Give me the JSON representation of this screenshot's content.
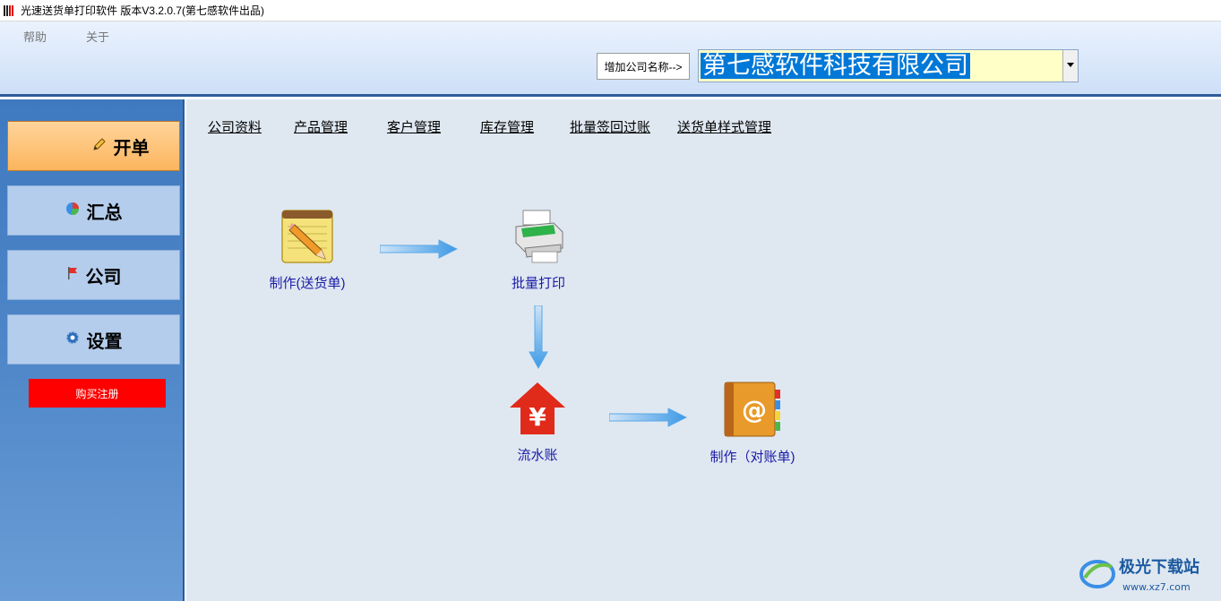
{
  "window": {
    "title": "光速送货单打印软件 版本V3.2.0.7(第七感软件出品)"
  },
  "menu": {
    "items": [
      "帮助",
      "关于"
    ]
  },
  "header": {
    "add_company_label": "增加公司名称-->",
    "company_selected": "第七感软件科技有限公司"
  },
  "sidebar": {
    "items": [
      {
        "label": "开单",
        "icon": "pencil-icon",
        "active": true
      },
      {
        "label": "汇总",
        "icon": "pie-chart-icon",
        "active": false
      },
      {
        "label": "公司",
        "icon": "flag-icon",
        "active": false
      },
      {
        "label": "设置",
        "icon": "gear-icon",
        "active": false
      }
    ],
    "buy_label": "购买注册"
  },
  "tabs": [
    "公司资料",
    "产品管理",
    "客户管理",
    "库存管理",
    "批量签回过账",
    "送货单样式管理"
  ],
  "flow": {
    "make_delivery": "制作(送货单)",
    "batch_print": "批量打印",
    "ledger": "流水账",
    "make_statement": "制作（对账单)"
  },
  "watermark": {
    "name": "极光下载站",
    "url": "www.xz7.com"
  },
  "colors": {
    "accent": "#2f5d9c",
    "active_tab": "#fcb55e",
    "buy_button": "#ff0000",
    "flow_label": "#1a1aa6"
  }
}
